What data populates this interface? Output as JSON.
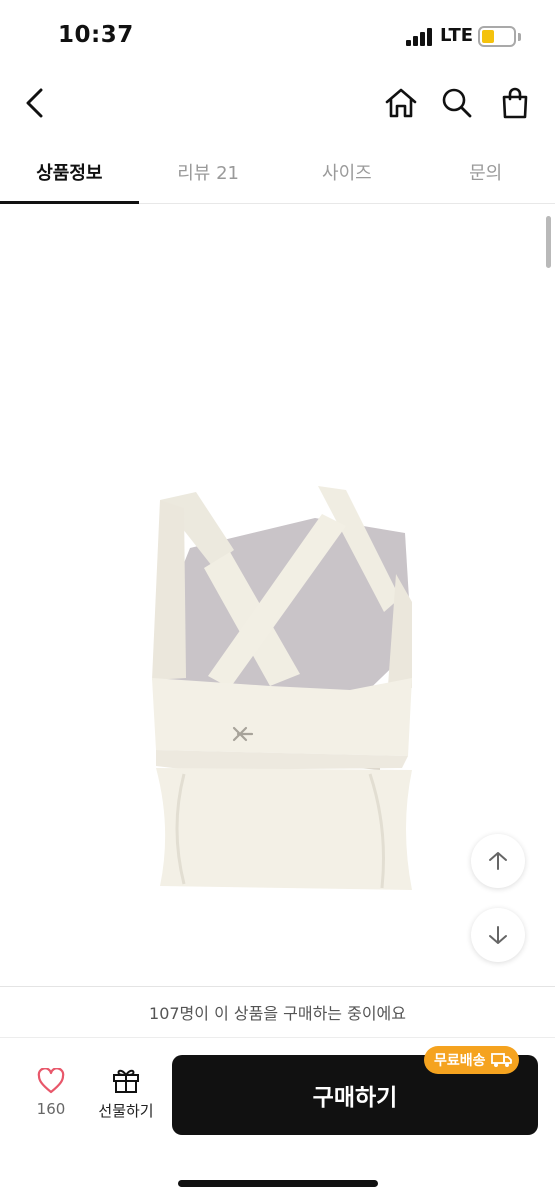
{
  "status_bar": {
    "time": "10:37",
    "network": "LTE",
    "battery_color": "#f4c20d"
  },
  "header": {
    "icons": [
      "chevron-left-icon",
      "home-icon",
      "search-icon",
      "shopping-bag-icon"
    ]
  },
  "tabs": [
    {
      "label": "상품정보",
      "active": true
    },
    {
      "label": "리뷰 21",
      "active": false
    },
    {
      "label": "사이즈",
      "active": false
    },
    {
      "label": "문의",
      "active": false
    }
  ],
  "content": {
    "product_image": "cream-cross-back-sports-top",
    "scroll_up_icon": "arrow-up-icon",
    "scroll_down_icon": "arrow-down-icon"
  },
  "bottom": {
    "purchase_notice": "107명이 이 상품을 구매하는 중이에요",
    "like_count": "160",
    "gift_label": "선물하기",
    "buy_label": "구매하기",
    "shipping_badge": "무료배송",
    "accent_color": "#f5a31f",
    "like_color": "#e8576a"
  }
}
